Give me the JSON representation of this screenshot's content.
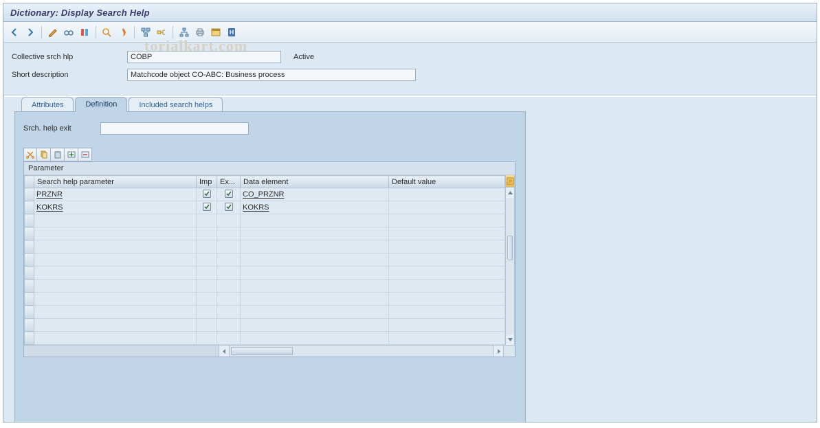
{
  "title": "Dictionary: Display Search Help",
  "toolbar_icons": [
    "back",
    "forward",
    "display-change",
    "other-object",
    "check",
    "activate",
    "where-used",
    "hierarchy",
    "indexes",
    "technical-settings",
    "append",
    "runtime-object",
    "documentation",
    "other-1",
    "other-2",
    "other-3",
    "info"
  ],
  "header": {
    "collective_label": "Collective srch hlp",
    "collective_value": "COBP",
    "status": "Active",
    "short_desc_label": "Short description",
    "short_desc_value": "Matchcode object CO-ABC: Business process"
  },
  "tabs": {
    "attributes": "Attributes",
    "definition": "Definition",
    "included": "Included search helps"
  },
  "exit": {
    "label": "Srch. help exit",
    "value": ""
  },
  "table": {
    "title": "Parameter",
    "columns": {
      "param": "Search help parameter",
      "imp": "Imp",
      "exp": "Ex...",
      "data_element": "Data element",
      "default": "Default value"
    },
    "rows": [
      {
        "param": "PRZNR",
        "imp": true,
        "exp": true,
        "data_element": "CO_PRZNR",
        "default": ""
      },
      {
        "param": "KOKRS",
        "imp": true,
        "exp": true,
        "data_element": "KOKRS",
        "default": ""
      },
      {
        "param": "",
        "imp": false,
        "exp": false,
        "data_element": "",
        "default": ""
      },
      {
        "param": "",
        "imp": false,
        "exp": false,
        "data_element": "",
        "default": ""
      },
      {
        "param": "",
        "imp": false,
        "exp": false,
        "data_element": "",
        "default": ""
      },
      {
        "param": "",
        "imp": false,
        "exp": false,
        "data_element": "",
        "default": ""
      },
      {
        "param": "",
        "imp": false,
        "exp": false,
        "data_element": "",
        "default": ""
      },
      {
        "param": "",
        "imp": false,
        "exp": false,
        "data_element": "",
        "default": ""
      },
      {
        "param": "",
        "imp": false,
        "exp": false,
        "data_element": "",
        "default": ""
      },
      {
        "param": "",
        "imp": false,
        "exp": false,
        "data_element": "",
        "default": ""
      },
      {
        "param": "",
        "imp": false,
        "exp": false,
        "data_element": "",
        "default": ""
      },
      {
        "param": "",
        "imp": false,
        "exp": false,
        "data_element": "",
        "default": ""
      }
    ]
  },
  "watermark": "torialkart.com"
}
